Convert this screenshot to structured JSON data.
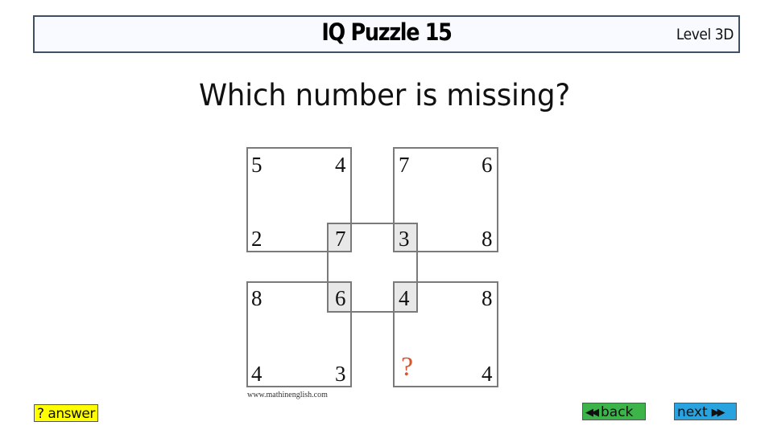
{
  "header": {
    "title": "IQ Puzzle 15",
    "level": "Level 3D"
  },
  "question": "Which number is missing?",
  "puzzle": {
    "boxes": [
      {
        "position": "top-left",
        "top_left": "5",
        "top_right": "4",
        "bottom_left": "2",
        "bottom_right": "7"
      },
      {
        "position": "top-right",
        "top_left": "7",
        "top_right": "6",
        "bottom_left": "3",
        "bottom_right": "8"
      },
      {
        "position": "bottom-left",
        "top_left": "8",
        "top_right": "6",
        "bottom_left": "4",
        "bottom_right": "3"
      },
      {
        "position": "bottom-right",
        "top_left": "4",
        "top_right": "8",
        "bottom_left": "?",
        "bottom_right": "4"
      }
    ],
    "shaded_cells": [
      "7",
      "3",
      "6",
      "4"
    ],
    "missing_marker": "?",
    "missing_color": "#d9542c",
    "credit": "www.mathinenglish.com"
  },
  "buttons": {
    "answer": "? answer",
    "back": "back",
    "back_icon": "◀◀",
    "next": "next",
    "next_icon": "▶▶"
  },
  "colors": {
    "answer_bg": "#ffff00",
    "back_bg": "#3cb44a",
    "next_bg": "#29a3e0",
    "header_border": "#3e4f66"
  }
}
